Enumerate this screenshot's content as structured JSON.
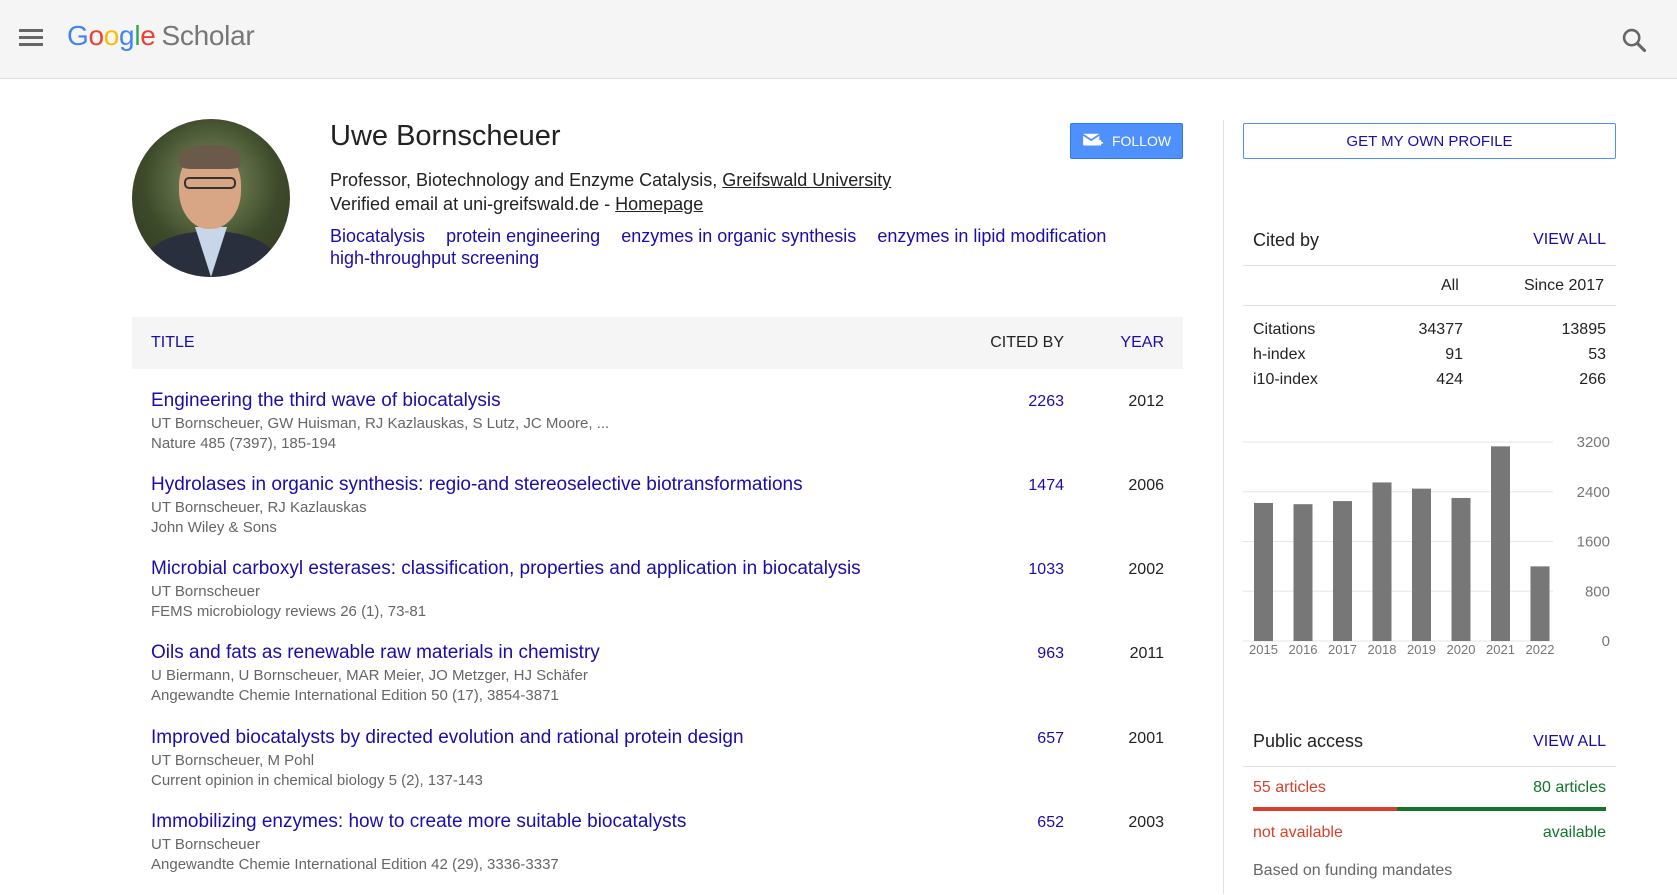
{
  "header": {
    "logo_letters": [
      "G",
      "o",
      "o",
      "g",
      "l",
      "e"
    ],
    "logo_suffix": "Scholar",
    "menu_icon": "hamburger-menu-icon",
    "search_icon": "search-icon"
  },
  "profile": {
    "name": "Uwe Bornscheuer",
    "affiliation_prefix": "Professor, Biotechnology and Enzyme Catalysis, ",
    "affiliation_link": "Greifswald University",
    "email_prefix": "Verified email at uni-greifswald.de - ",
    "homepage_link": "Homepage",
    "interests": [
      "Biocatalysis",
      "protein engineering",
      "enzymes in organic synthesis",
      "enzymes in lipid modification",
      "high-throughput screening"
    ],
    "follow_label": "FOLLOW"
  },
  "table": {
    "headers": {
      "title": "TITLE",
      "cited_by": "CITED BY",
      "year": "YEAR"
    },
    "rows": [
      {
        "title": "Engineering the third wave of biocatalysis",
        "authors": "UT Bornscheuer, GW Huisman, RJ Kazlauskas, S Lutz, JC Moore, ...",
        "venue": "Nature 485 (7397), 185-194",
        "cited": "2263",
        "year": "2012"
      },
      {
        "title": "Hydrolases in organic synthesis: regio-and stereoselective biotransformations",
        "authors": "UT Bornscheuer, RJ Kazlauskas",
        "venue": "John Wiley & Sons",
        "cited": "1474",
        "year": "2006"
      },
      {
        "title": "Microbial carboxyl esterases: classification, properties and application in biocatalysis",
        "authors": "UT Bornscheuer",
        "venue": "FEMS microbiology reviews 26 (1), 73-81",
        "cited": "1033",
        "year": "2002"
      },
      {
        "title": "Oils and fats as renewable raw materials in chemistry",
        "authors": "U Biermann, U Bornscheuer, MAR Meier, JO Metzger, HJ Schäfer",
        "venue": "Angewandte Chemie International Edition 50 (17), 3854-3871",
        "cited": "963",
        "year": "2011"
      },
      {
        "title": "Improved biocatalysts by directed evolution and rational protein design",
        "authors": "UT Bornscheuer, M Pohl",
        "venue": "Current opinion in chemical biology 5 (2), 137-143",
        "cited": "657",
        "year": "2001"
      },
      {
        "title": "Immobilizing enzymes: how to create more suitable biocatalysts",
        "authors": "UT Bornscheuer",
        "venue": "Angewandte Chemie International Edition 42 (29), 3336-3337",
        "cited": "652",
        "year": "2003"
      }
    ]
  },
  "sidebar": {
    "own_profile_label": "GET MY OWN PROFILE",
    "cited_by": {
      "heading": "Cited by",
      "view_all": "VIEW ALL",
      "col_all": "All",
      "col_since": "Since 2017",
      "rows": [
        {
          "label": "Citations",
          "all": "34377",
          "since": "13895"
        },
        {
          "label": "h-index",
          "all": "91",
          "since": "53"
        },
        {
          "label": "i10-index",
          "all": "424",
          "since": "266"
        }
      ]
    },
    "public_access": {
      "heading": "Public access",
      "view_all": "VIEW ALL",
      "not_available_count": "55 articles",
      "available_count": "80 articles",
      "not_available_label": "not available",
      "available_label": "available",
      "not_available_fraction": 0.407,
      "note": "Based on funding mandates",
      "red_color": "#d9402b",
      "green_color": "#11752a"
    }
  },
  "chart_data": {
    "type": "bar",
    "categories": [
      "2015",
      "2016",
      "2017",
      "2018",
      "2019",
      "2020",
      "2021",
      "2022"
    ],
    "values": [
      2220,
      2200,
      2250,
      2550,
      2450,
      2300,
      3130,
      1200
    ],
    "yticks": [
      "0",
      "800",
      "1600",
      "2400",
      "3200"
    ],
    "ylim": [
      0,
      3200
    ],
    "grid": true,
    "bar_color": "#777777"
  }
}
